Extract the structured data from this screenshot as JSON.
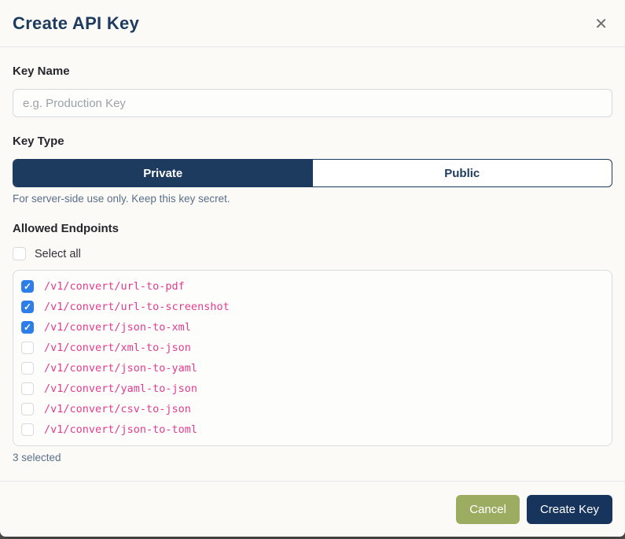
{
  "modal": {
    "title": "Create API Key",
    "close_icon": "✕"
  },
  "key_name": {
    "label": "Key Name",
    "value": "",
    "placeholder": "e.g. Production Key"
  },
  "key_type": {
    "label": "Key Type",
    "options": [
      {
        "label": "Private",
        "selected": true
      },
      {
        "label": "Public",
        "selected": false
      }
    ],
    "helper_text": "For server-side use only. Keep this key secret."
  },
  "endpoints": {
    "label": "Allowed Endpoints",
    "select_all_label": "Select all",
    "select_all_checked": false,
    "items": [
      {
        "path": "/v1/convert/url-to-pdf",
        "checked": true
      },
      {
        "path": "/v1/convert/url-to-screenshot",
        "checked": true
      },
      {
        "path": "/v1/convert/json-to-xml",
        "checked": true
      },
      {
        "path": "/v1/convert/xml-to-json",
        "checked": false
      },
      {
        "path": "/v1/convert/json-to-yaml",
        "checked": false
      },
      {
        "path": "/v1/convert/yaml-to-json",
        "checked": false
      },
      {
        "path": "/v1/convert/csv-to-json",
        "checked": false
      },
      {
        "path": "/v1/convert/json-to-toml",
        "checked": false
      }
    ],
    "selected_count_text": "3 selected"
  },
  "footer": {
    "cancel_label": "Cancel",
    "create_label": "Create Key"
  },
  "colors": {
    "navy": "#1d3a5f",
    "navy_dark": "#16345c",
    "olive": "#9cad62",
    "checkbox_blue": "#2e7ee9",
    "endpoint_pink": "#e23c8e",
    "muted_text": "#5a6f8a",
    "background": "#fbfaf7"
  }
}
